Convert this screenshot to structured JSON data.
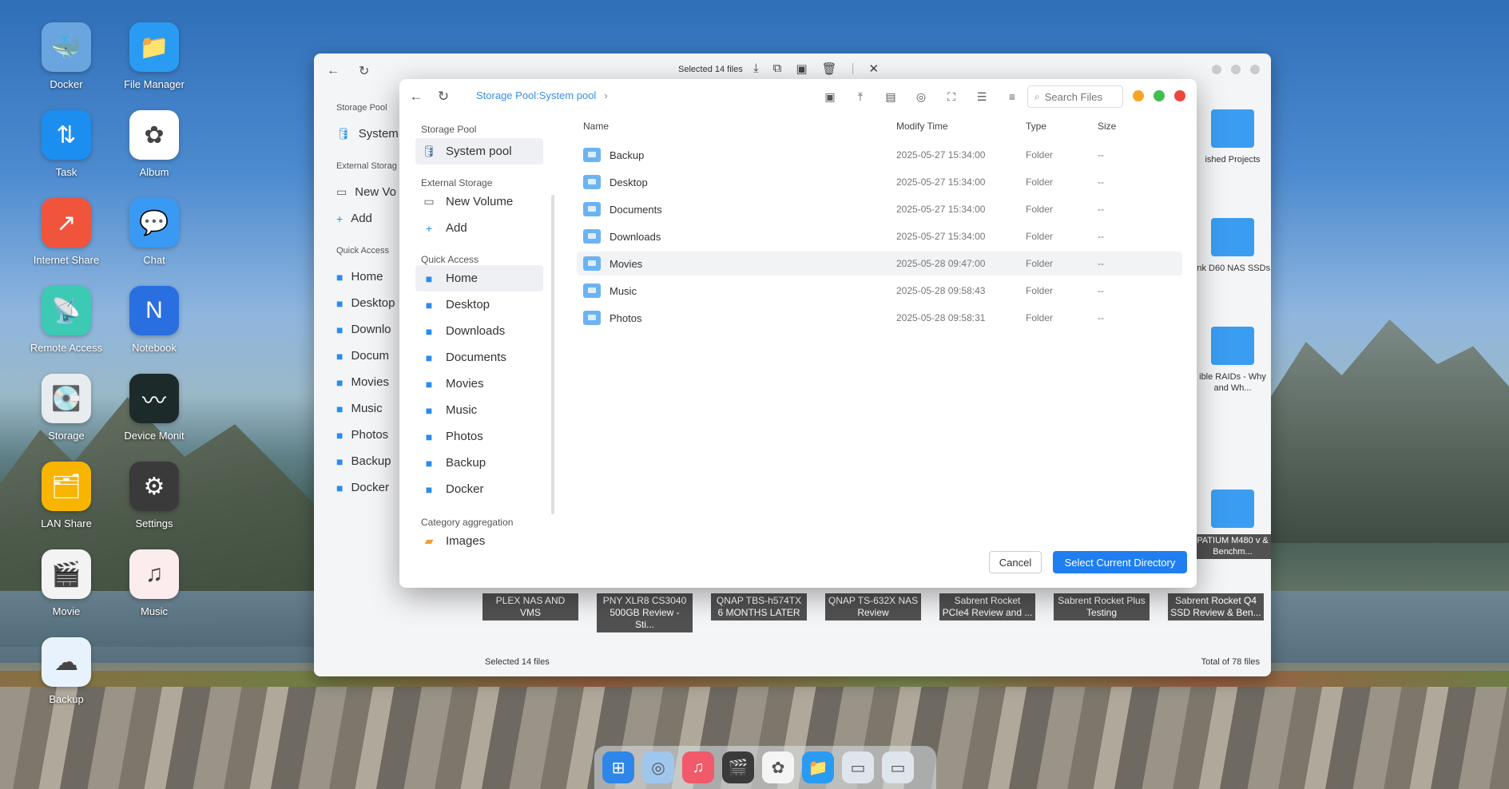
{
  "desktop_icons": [
    {
      "label": "Docker",
      "icon": "docker-icon",
      "glyph": "🐳",
      "color": "#6ba5e0"
    },
    {
      "label": "File Manager",
      "icon": "folder-icon",
      "glyph": "📁",
      "color": "#2a9bf2"
    },
    {
      "label": "Task",
      "icon": "task-icon",
      "glyph": "⇅",
      "color": "#1b8ef0"
    },
    {
      "label": "Album",
      "icon": "album-icon",
      "glyph": "✿",
      "color": "#ffffff"
    },
    {
      "label": "Internet Share",
      "icon": "share-icon",
      "glyph": "↗",
      "color": "#f0553c"
    },
    {
      "label": "Chat",
      "icon": "chat-icon",
      "glyph": "💬",
      "color": "#3a9af3"
    },
    {
      "label": "Remote Access",
      "icon": "remote-access-icon",
      "glyph": "📡",
      "color": "#3ccab4"
    },
    {
      "label": "Notebook",
      "icon": "notebook-icon",
      "glyph": "N",
      "color": "#2a6fe0"
    },
    {
      "label": "Storage",
      "icon": "storage-icon",
      "glyph": "💽",
      "color": "#e9ecef"
    },
    {
      "label": "Device Monit",
      "icon": "monitor-icon",
      "glyph": "〰",
      "color": "#1d2a2a"
    },
    {
      "label": "LAN Share",
      "icon": "lan-share-icon",
      "glyph": "🗂",
      "color": "#f7b500"
    },
    {
      "label": "Settings",
      "icon": "settings-icon",
      "glyph": "⚙",
      "color": "#3a3a3a"
    },
    {
      "label": "Movie",
      "icon": "movie-icon",
      "glyph": "🎬",
      "color": "#f3f3f3"
    },
    {
      "label": "Music",
      "icon": "music-icon",
      "glyph": "♫",
      "color": "#fdecee"
    },
    {
      "label": "Backup",
      "icon": "backup-icon",
      "glyph": "☁",
      "color": "#e8f2fd"
    }
  ],
  "bg_window": {
    "selected": "Selected 14 files",
    "status_left": "Selected 14 files",
    "status_right": "Total of 78 files",
    "sidebar": {
      "storage_pool": "Storage Pool",
      "system": "System",
      "external": "External Storag",
      "new_volume": "New Vo",
      "add": "Add",
      "quick": "Quick Access",
      "items": [
        "Home",
        "Desktop",
        "Downlo",
        "Docum",
        "Movies",
        "Music",
        "Photos",
        "Backup",
        "Docker"
      ]
    },
    "right_tiles": [
      "ished Projects",
      "ink D60 NAS SSDs",
      "ible RAIDs - Why and Wh...",
      "PATIUM M480 v & Benchm..."
    ],
    "bottom_captions": [
      "PLEX NAS AND VMS",
      "PNY XLR8 CS3040 500GB Review - Sti...",
      "QNAP TBS-h574TX 6 MONTHS LATER",
      "QNAP TS-632X NAS Review",
      "Sabrent Rocket PCIe4 Review and ...",
      "Sabrent Rocket Plus Testing",
      "Sabrent Rocket Q4 SSD Review & Ben..."
    ]
  },
  "dialog": {
    "breadcrumb": "Storage Pool:System pool",
    "search_placeholder": "Search Files",
    "sidebar": {
      "storage_pool": "Storage Pool",
      "system_pool": "System pool",
      "external_storage": "External Storage",
      "new_volume": "New Volume",
      "add": "Add",
      "quick_access": "Quick Access",
      "quick_items": [
        "Home",
        "Desktop",
        "Downloads",
        "Documents",
        "Movies",
        "Music",
        "Photos",
        "Backup",
        "Docker"
      ],
      "category": "Category aggregation",
      "images": "Images"
    },
    "columns": {
      "name": "Name",
      "modify": "Modify Time",
      "type": "Type",
      "size": "Size"
    },
    "rows": [
      {
        "name": "Backup",
        "time": "2025-05-27 15:34:00",
        "type": "Folder",
        "size": "--"
      },
      {
        "name": "Desktop",
        "time": "2025-05-27 15:34:00",
        "type": "Folder",
        "size": "--"
      },
      {
        "name": "Documents",
        "time": "2025-05-27 15:34:00",
        "type": "Folder",
        "size": "--"
      },
      {
        "name": "Downloads",
        "time": "2025-05-27 15:34:00",
        "type": "Folder",
        "size": "--"
      },
      {
        "name": "Movies",
        "time": "2025-05-28 09:47:00",
        "type": "Folder",
        "size": "--"
      },
      {
        "name": "Music",
        "time": "2025-05-28 09:58:43",
        "type": "Folder",
        "size": "--"
      },
      {
        "name": "Photos",
        "time": "2025-05-28 09:58:31",
        "type": "Folder",
        "size": "--"
      }
    ],
    "cancel_label": "Cancel",
    "select_label": "Select Current Directory",
    "colors": {
      "accent": "#1f7ef0",
      "light_orange": "#f5a524",
      "light_green": "#3fbf4f",
      "light_red": "#f0453c"
    }
  },
  "dock": [
    {
      "icon": "launcher-icon",
      "glyph": "⊞",
      "color": "#2f86e8"
    },
    {
      "icon": "app-store-icon",
      "glyph": "◎",
      "color": "#9fc7ee"
    },
    {
      "icon": "music-icon",
      "glyph": "♫",
      "color": "#f05a6a"
    },
    {
      "icon": "movie-icon",
      "glyph": "🎬",
      "color": "#3a3a3a"
    },
    {
      "icon": "album-icon",
      "glyph": "✿",
      "color": "#f5f5f5"
    },
    {
      "icon": "file-manager-icon",
      "glyph": "📁",
      "color": "#2a9bf2"
    },
    {
      "icon": "window-1-icon",
      "glyph": "▭",
      "color": "#dfe5ec"
    },
    {
      "icon": "window-2-icon",
      "glyph": "▭",
      "color": "#dfe5ec"
    }
  ]
}
